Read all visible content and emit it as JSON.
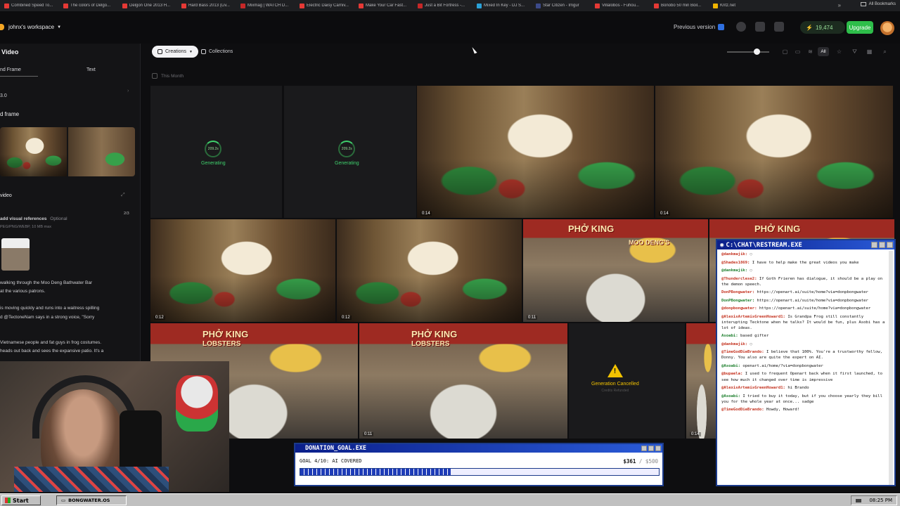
{
  "bookmarks": {
    "items": [
      "Combined Speed To...",
      "The colors of Delgo...",
      "Delgon One 2013 H...",
      "Hard Bass 2013 (Liv...",
      "Mixmag | WATCH D...",
      "Electric Daisy Carniv...",
      "Make Your Car Fast...",
      "Just a Bit Fortress -...",
      "Mixed In Key - DJ S...",
      "Star Citizen - Imgur",
      "Villalobos - Fuhou...",
      "Bonobo 50 min Boil...",
      "Kritz.net"
    ],
    "more": "»",
    "all": "All Bookmarks"
  },
  "topbar": {
    "workspace": "johnx's workspace",
    "previous_version": "Previous version",
    "credits": "19,474",
    "upgrade": "Upgrade"
  },
  "sidebar": {
    "title": "Video",
    "tab_frame": "nd Frame",
    "tab_text": "Text",
    "model": "3.0",
    "frame_section": "d frame",
    "video_section": "video",
    "visual_refs": "add visual references",
    "optional": "Optional",
    "refs_count": "2/3",
    "formats": "PEG/PNG/WEBP, 10 MB max",
    "prompt_lines": [
      "walking through the Moo Deng Bathwater Bar",
      "at the various patrons.",
      "is moving quickly and runs into a waitress spilling",
      "d  @TectoneNam  says in a strong voice, \"Sorry",
      "Vietnamese people and fat guys in frog costumes.",
      "heads out back and sees the expansive patio. It's a"
    ]
  },
  "main": {
    "creations": "Creations",
    "collections": "Collections",
    "this_month": "This Month",
    "view_all": "All",
    "generating": "Generating",
    "progress_label": "209.2s",
    "generation_cancelled": "Generation Cancelled",
    "credits_refunded": "Credits Refunded",
    "signs": [
      "PHỞ KING",
      "LOBSTERS",
      "MOO DENG'S"
    ],
    "durations": [
      "0:14",
      "0:14",
      "0:12",
      "0:12",
      "0:11",
      "0:11",
      "0:14"
    ]
  },
  "chat": {
    "title": "C:\\CHAT\\RESTREAM.EXE",
    "messages": [
      {
        "user": "@dankmajik:",
        "text": "◌"
      },
      {
        "user": "@Shades1869:",
        "text": "I have to help make the great videos you make"
      },
      {
        "user": "@dankmajik:",
        "text": "◌"
      },
      {
        "user": "@Thunderclese2:",
        "text": "If Goth Frieren has dialogue, it should be a play on the demon speech."
      },
      {
        "user": "DonPBongwater:",
        "text": "https://openart.ai/suite/home?via=donpbongwater"
      },
      {
        "user": "DonPBongwater:",
        "text": "https://openart.ai/suite/home?via=donpbongwater"
      },
      {
        "user": "@donpbongwater:",
        "text": "https://openart.ai/suite/home?via=donpbongwater"
      },
      {
        "user": "@AlexisArtemisGreenHoward1:",
        "text": "Is Grandpa Frog still constantly interupting Tecktone when he talks? It would be fun, plus Asobi has a lot of ideas."
      },
      {
        "user": "Asoabi:",
        "text": "based gifter"
      },
      {
        "user": "@dankmajik:",
        "text": "◌"
      },
      {
        "user": "@TimeGodDieBrando:",
        "text": "I believe that 100%. You're a trustworthy fellow, Donny. You also are quite the expert on AI."
      },
      {
        "user": "@Asoabi:",
        "text": "openart.ai/home/?via=donpbongwater"
      },
      {
        "user": "@bupaela:",
        "text": "I used to frequent Openart back when it first launched, to see how much it changed over time is impressive"
      },
      {
        "user": "@AlexisArtemisGreenHoward1:",
        "text": "hi Brando"
      },
      {
        "user": "@Asoabi:",
        "text": "I tried to buy it today, but if you choose yearly they bill you for the whole year at once... sadge"
      },
      {
        "user": "@TimeGodDieBrando:",
        "text": "Howdy, Howard!"
      }
    ]
  },
  "donation": {
    "title": "DONATION_GOAL.EXE",
    "label": "GOAL 4/10: AI COVERED",
    "current": "$361",
    "goal": " / $500",
    "progress": 0.42
  },
  "taskbar": {
    "start": "Start",
    "task": "BONGWATER.OS",
    "clock": "08:25 PM"
  }
}
